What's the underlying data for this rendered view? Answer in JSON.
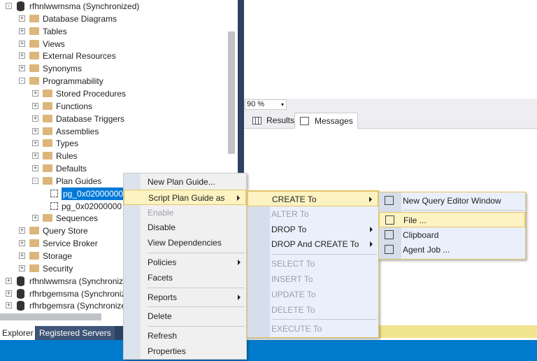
{
  "tree": [
    {
      "label": "rfhnlwwmsma (Synchronized)",
      "level": 0,
      "type": "db",
      "exp": "-"
    },
    {
      "label": "Database Diagrams",
      "level": 1,
      "type": "folder",
      "exp": "+"
    },
    {
      "label": "Tables",
      "level": 1,
      "type": "folder",
      "exp": "+"
    },
    {
      "label": "Views",
      "level": 1,
      "type": "folder",
      "exp": "+"
    },
    {
      "label": "External Resources",
      "level": 1,
      "type": "folder",
      "exp": "+"
    },
    {
      "label": "Synonyms",
      "level": 1,
      "type": "folder",
      "exp": "+"
    },
    {
      "label": "Programmability",
      "level": 1,
      "type": "folder",
      "exp": "-"
    },
    {
      "label": "Stored Procedures",
      "level": 2,
      "type": "folder",
      "exp": "+"
    },
    {
      "label": "Functions",
      "level": 2,
      "type": "folder",
      "exp": "+"
    },
    {
      "label": "Database Triggers",
      "level": 2,
      "type": "folder",
      "exp": "+"
    },
    {
      "label": "Assemblies",
      "level": 2,
      "type": "folder",
      "exp": "+"
    },
    {
      "label": "Types",
      "level": 2,
      "type": "folder",
      "exp": "+"
    },
    {
      "label": "Rules",
      "level": 2,
      "type": "folder",
      "exp": "+"
    },
    {
      "label": "Defaults",
      "level": 2,
      "type": "folder",
      "exp": "+"
    },
    {
      "label": "Plan Guides",
      "level": 2,
      "type": "folder",
      "exp": "-"
    },
    {
      "label": "pg_0x02000000",
      "level": 3,
      "type": "guide",
      "exp": "",
      "selected": true
    },
    {
      "label": "pg_0x02000000",
      "level": 3,
      "type": "guide",
      "exp": ""
    },
    {
      "label": "Sequences",
      "level": 2,
      "type": "folder",
      "exp": "+"
    },
    {
      "label": "Query Store",
      "level": 1,
      "type": "folder",
      "exp": "+"
    },
    {
      "label": "Service Broker",
      "level": 1,
      "type": "folder",
      "exp": "+"
    },
    {
      "label": "Storage",
      "level": 1,
      "type": "folder",
      "exp": "+"
    },
    {
      "label": "Security",
      "level": 1,
      "type": "folder",
      "exp": "+"
    },
    {
      "label": "rfhnlwwmsra (Synchronized)",
      "level": 0,
      "type": "db",
      "exp": "+"
    },
    {
      "label": "rfhrbgemsma (Synchronized)",
      "level": 0,
      "type": "db",
      "exp": "+"
    },
    {
      "label": "rfhrbgemsra (Synchronized)",
      "level": 0,
      "type": "db",
      "exp": "+"
    }
  ],
  "bottom_tabs": {
    "explorer": "Explorer",
    "registered": "Registered Servers"
  },
  "zoom": {
    "value": "90 %"
  },
  "result_tabs": {
    "results": "Results",
    "messages": "Messages"
  },
  "context_menu": [
    {
      "label": "New Plan Guide..."
    },
    {
      "label": "Script Plan Guide as",
      "submenu": true,
      "highlighted": true
    },
    {
      "label": "Enable",
      "disabled": true
    },
    {
      "label": "Disable"
    },
    {
      "label": "View Dependencies",
      "sep_after": true
    },
    {
      "label": "Policies",
      "submenu": true
    },
    {
      "label": "Facets",
      "sep_after": true
    },
    {
      "label": "Reports",
      "submenu": true,
      "sep_after": true
    },
    {
      "label": "Delete",
      "sep_after": true
    },
    {
      "label": "Refresh"
    },
    {
      "label": "Properties"
    }
  ],
  "script_menu": [
    {
      "label": "CREATE To",
      "submenu": true,
      "highlighted": true
    },
    {
      "label": "ALTER To",
      "disabled": true
    },
    {
      "label": "DROP To",
      "submenu": true
    },
    {
      "label": "DROP And CREATE To",
      "submenu": true,
      "sep_after": true
    },
    {
      "label": "SELECT To",
      "disabled": true
    },
    {
      "label": "INSERT To",
      "disabled": true
    },
    {
      "label": "UPDATE To",
      "disabled": true
    },
    {
      "label": "DELETE To",
      "disabled": true,
      "sep_after": true
    },
    {
      "label": "EXECUTE To",
      "disabled": true
    }
  ],
  "create_menu": [
    {
      "label": "New Query Editor Window",
      "icon": "query-window-icon",
      "sep_after": true
    },
    {
      "label": "File ...",
      "icon": "save-file-icon",
      "highlighted": true
    },
    {
      "label": "Clipboard",
      "icon": "clipboard-icon"
    },
    {
      "label": "Agent Job ...",
      "icon": "agent-job-icon"
    }
  ],
  "colors": {
    "accent": "#007acc",
    "selection": "#0078d7",
    "menu_highlight": "#fdf3c2",
    "panel_dark": "#2d4163"
  }
}
